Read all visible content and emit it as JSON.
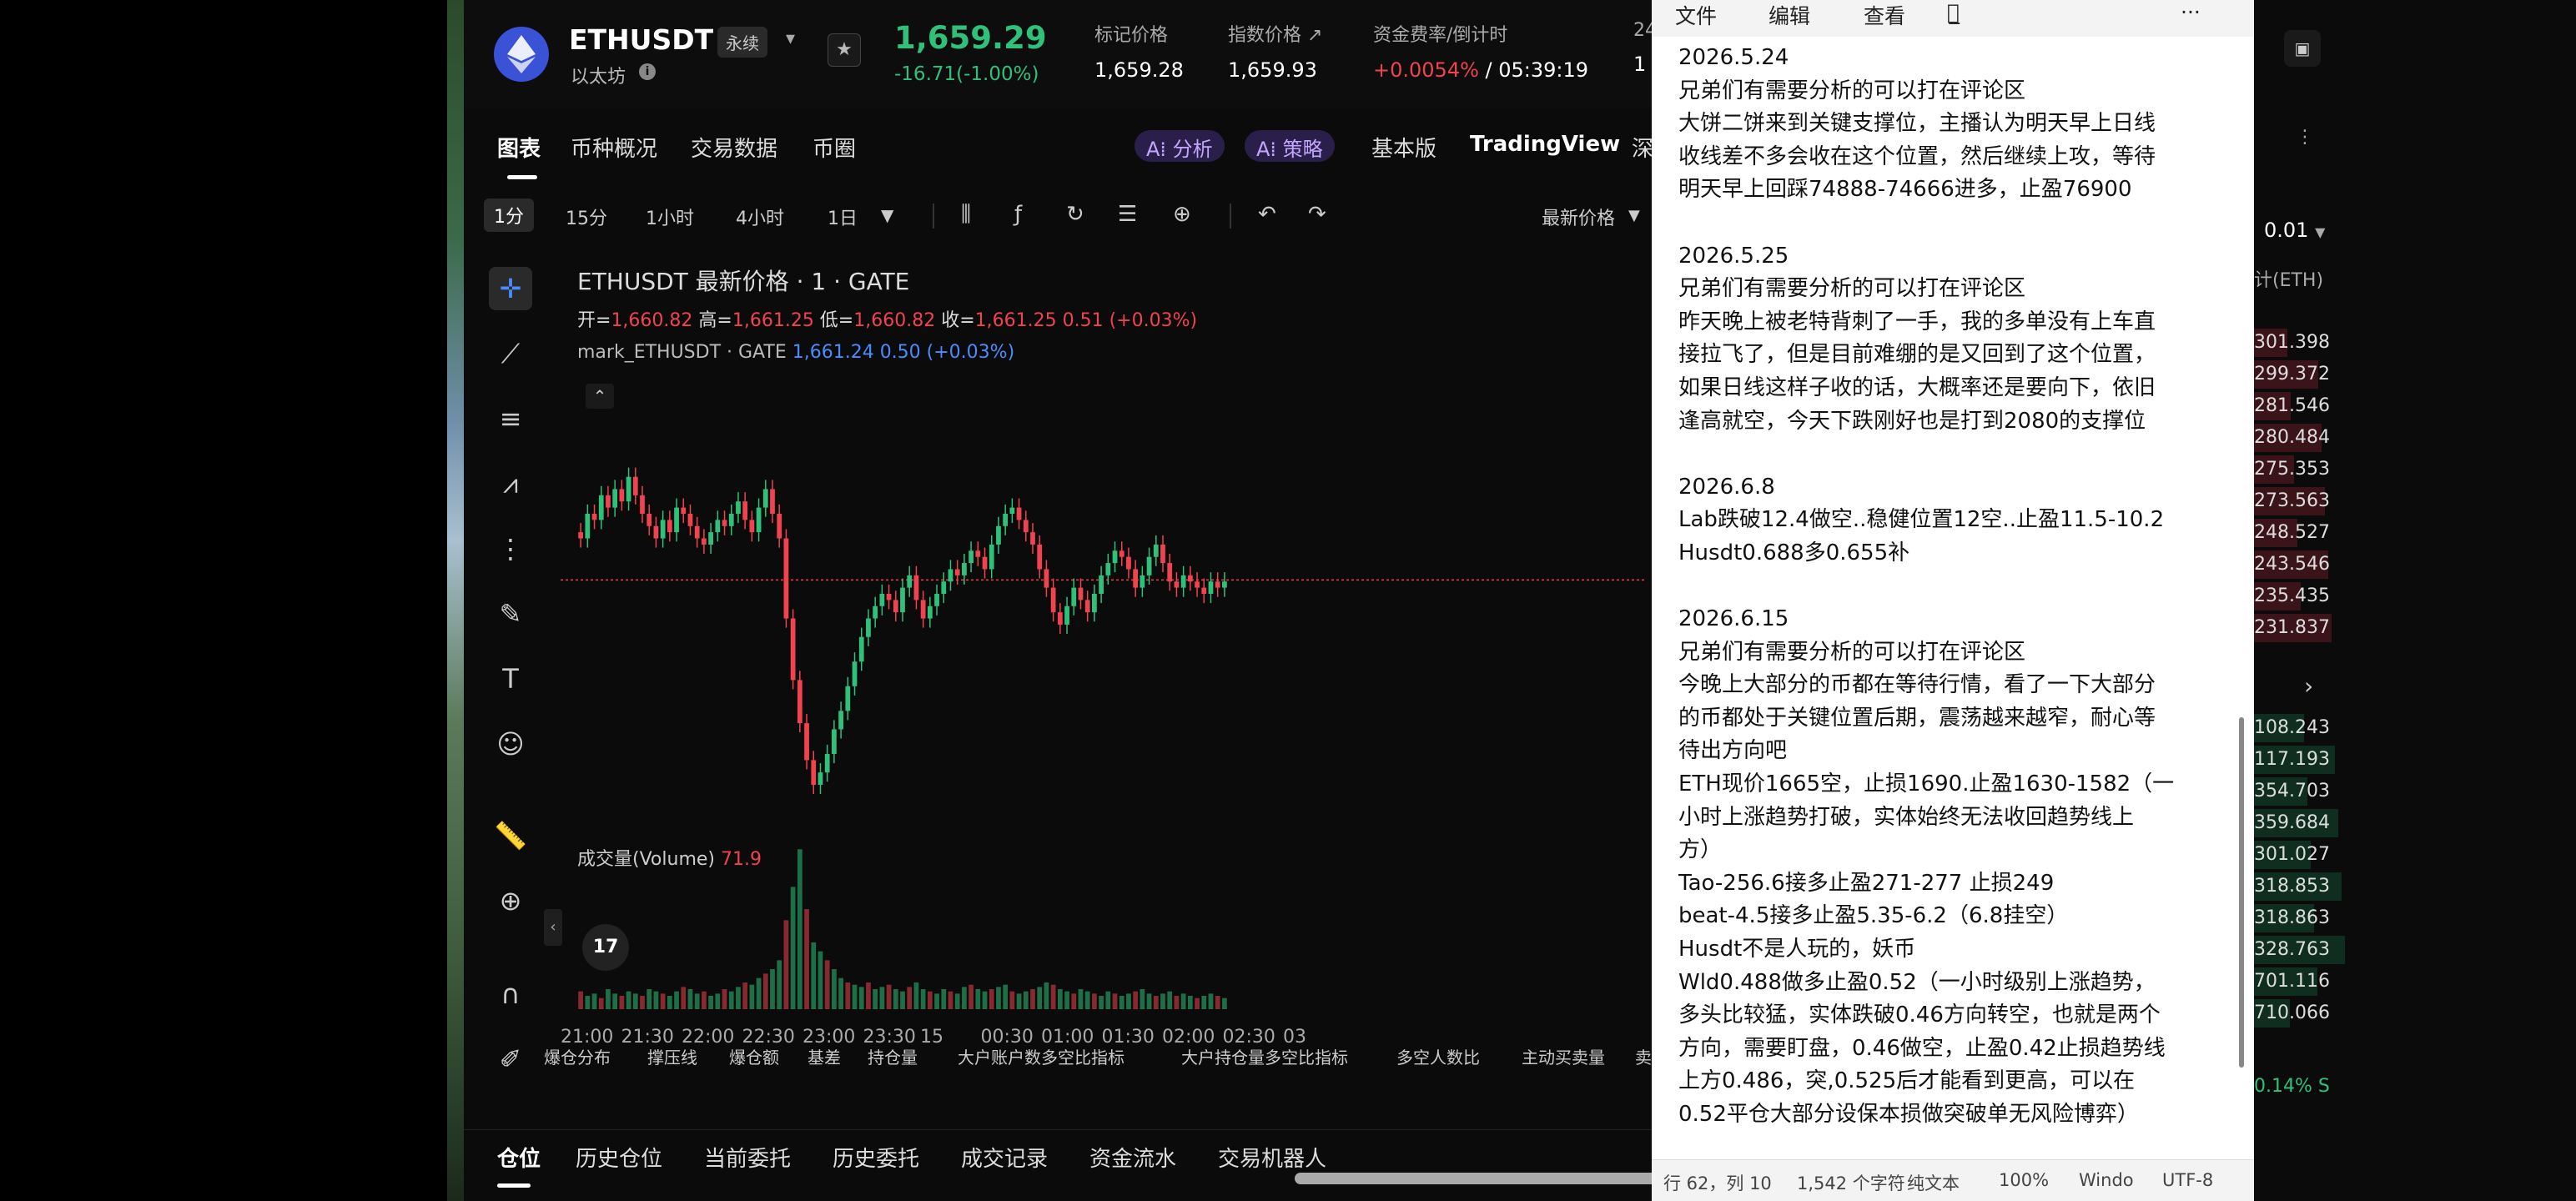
{
  "header": {
    "symbol": "ETHUSDT",
    "perp_badge": "永续",
    "coin_name": "以太坊",
    "last_price": "1,659.29",
    "price_change": "-16.71(-1.00%)",
    "mark_label": "标记价格",
    "mark_value": "1,659.28",
    "index_label": "指数价格 ↗",
    "index_value": "1,659.93",
    "funding_label": "资金费率/倒计时",
    "funding_rate": "+0.0054%",
    "funding_countdown": " / 05:39:19",
    "extra_label": "24",
    "extra_value": "1"
  },
  "tabs": {
    "chart": "图表",
    "overview": "币种概况",
    "trading_data": "交易数据",
    "circle": "币圈",
    "ai_analysis": "A⁞ 分析",
    "ai_strategy": "A⁞ 策略",
    "basic": "基本版",
    "tradingview": "TradingView",
    "depth": "深"
  },
  "toolbar": {
    "tf_1m": "1分",
    "tf_15m": "15分",
    "tf_1h": "1小时",
    "tf_4h": "4小时",
    "tf_1d": "1日",
    "latest_price": "最新价格"
  },
  "chart": {
    "title": "ETHUSDT 最新价格 · 1 · GATE",
    "ohlc_open_lbl": "开=",
    "ohlc_open": "1,660.82",
    "ohlc_high_lbl": " 高=",
    "ohlc_high": "1,661.25",
    "ohlc_low_lbl": " 低=",
    "ohlc_low": "1,660.82",
    "ohlc_close_lbl": " 收=",
    "ohlc_close": "1,661.25",
    "ohlc_change": " 0.51 (+0.03%)",
    "mark_series": "mark_ETHUSDT · GATE",
    "mark_series_value": " 1,661.24 0.50 (+0.03%)",
    "volume_label": "成交量(Volume)",
    "volume_value": " 71.9",
    "tv_logo": "17"
  },
  "chart_data": {
    "type": "candlestick",
    "x_ticks": [
      "21:00",
      "21:30",
      "22:00",
      "22:30",
      "23:00",
      "23:30",
      "15",
      "00:30",
      "01:00",
      "01:30",
      "02:00",
      "02:30",
      "03"
    ],
    "close_series": [
      1668,
      1672,
      1671,
      1675,
      1673,
      1676,
      1674,
      1678,
      1675,
      1672,
      1670,
      1668,
      1671,
      1669,
      1673,
      1672,
      1670,
      1668,
      1667,
      1669,
      1671,
      1670,
      1672,
      1674,
      1671,
      1669,
      1673,
      1676,
      1672,
      1668,
      1655,
      1645,
      1638,
      1632,
      1628,
      1630,
      1633,
      1637,
      1640,
      1644,
      1648,
      1652,
      1655,
      1657,
      1659,
      1658,
      1656,
      1660,
      1662,
      1658,
      1655,
      1657,
      1659,
      1661,
      1663,
      1662,
      1664,
      1666,
      1665,
      1663,
      1667,
      1670,
      1672,
      1673,
      1671,
      1669,
      1667,
      1663,
      1660,
      1656,
      1654,
      1657,
      1660,
      1658,
      1656,
      1659,
      1662,
      1664,
      1666,
      1665,
      1663,
      1660,
      1662,
      1665,
      1667,
      1664,
      1661,
      1660,
      1662,
      1661,
      1660,
      1659,
      1661,
      1660,
      1661
    ],
    "reference_price_line": 1661.25,
    "volume_series": [
      8,
      6,
      7,
      5,
      9,
      7,
      6,
      8,
      7,
      6,
      9,
      8,
      7,
      6,
      8,
      10,
      9,
      7,
      8,
      6,
      7,
      9,
      8,
      10,
      12,
      11,
      14,
      16,
      18,
      22,
      40,
      55,
      71.9,
      45,
      30,
      26,
      22,
      18,
      14,
      12,
      11,
      10,
      12,
      9,
      10,
      11,
      9,
      8,
      10,
      12,
      9,
      8,
      7,
      9,
      8,
      7,
      10,
      11,
      9,
      8,
      9,
      10,
      11,
      8,
      7,
      8,
      9,
      10,
      12,
      11,
      9,
      8,
      7,
      9,
      8,
      7,
      6,
      8,
      7,
      6,
      7,
      8,
      9,
      7,
      6,
      7,
      8,
      6,
      7,
      6,
      5,
      6,
      7,
      6,
      5
    ]
  },
  "indicators": [
    "爆仓分布",
    "撑压线",
    "爆仓额",
    "基差",
    "持仓量",
    "大户账户数多空比指标",
    "大户持仓量多空比指标",
    "多空人数比",
    "主动买卖量",
    "卖"
  ],
  "bottom_tabs": [
    "仓位",
    "历史仓位",
    "当前委托",
    "历史委托",
    "成交记录",
    "资金流水",
    "交易机器人"
  ],
  "order_book": {
    "step": "0.01",
    "unit": "计(ETH)",
    "rows": [
      "301.398",
      "299.372",
      "281.546",
      "280.484",
      "275.353",
      "273.563",
      "248.527",
      "243.546",
      "235.435",
      "231.837",
      "108.243",
      "117.193",
      "354.703",
      "359.684",
      "301.027",
      "318.853",
      "318.863",
      "328.763",
      "701.116",
      "710.066"
    ],
    "footer": "0.14% S"
  },
  "notepad": {
    "menu": [
      "文件",
      "编辑",
      "查看",
      "Ａ̲",
      "···"
    ],
    "content": "2026.5.24\n兄弟们有需要分析的可以打在评论区\n大饼二饼来到关键支撑位，主播认为明天早上日线\n收线差不多会收在这个位置，然后继续上攻，等待\n明天早上回踩74888-74666进多，止盈76900\n\n2026.5.25\n兄弟们有需要分析的可以打在评论区\n昨天晚上被老特背刺了一手，我的多单没有上车直\n接拉飞了，但是目前难绷的是又回到了这个位置，\n如果日线这样子收的话，大概率还是要向下，依旧\n逢高就空，今天下跌刚好也是打到2080的支撑位\n\n2026.6.8\nLab跌破12.4做空..稳健位置12空..止盈11.5-10.2\nHusdt0.688多0.655补\n\n2026.6.15\n兄弟们有需要分析的可以打在评论区\n今晚上大部分的币都在等待行情，看了一下大部分\n的币都处于关键位置后期，震荡越来越窄，耐心等\n待出方向吧\nETH现价1665空，止损1690.止盈1630-1582（一\n小时上涨趋势打破，实体始终无法收回趋势线上\n方）\nTao-256.6接多止盈271-277 止损249\nbeat-4.5接多止盈5.35-6.2（6.8挂空）\nHusdt不是人玩的，妖币\nWld0.488做多止盈0.52（一小时级别上涨趋势，\n多头比较猛，实体跌破0.46方向转空，也就是两个\n方向，需要盯盘，0.46做空，止盈0.42止损趋势线\n上方0.486，突,0.525后才能看到更高，可以在\n0.52平仓大部分设保本损做突破单无风险博弈）",
    "status_pos": "行 62，列 10",
    "status_chars": "1,542 个字符",
    "status_format": "纯文本",
    "status_zoom": "100%",
    "status_eol": "Windo",
    "status_enc": "UTF-8"
  },
  "colors": {
    "up": "#2fc17a",
    "down": "#f0424f",
    "accent": "#4a8cff"
  }
}
